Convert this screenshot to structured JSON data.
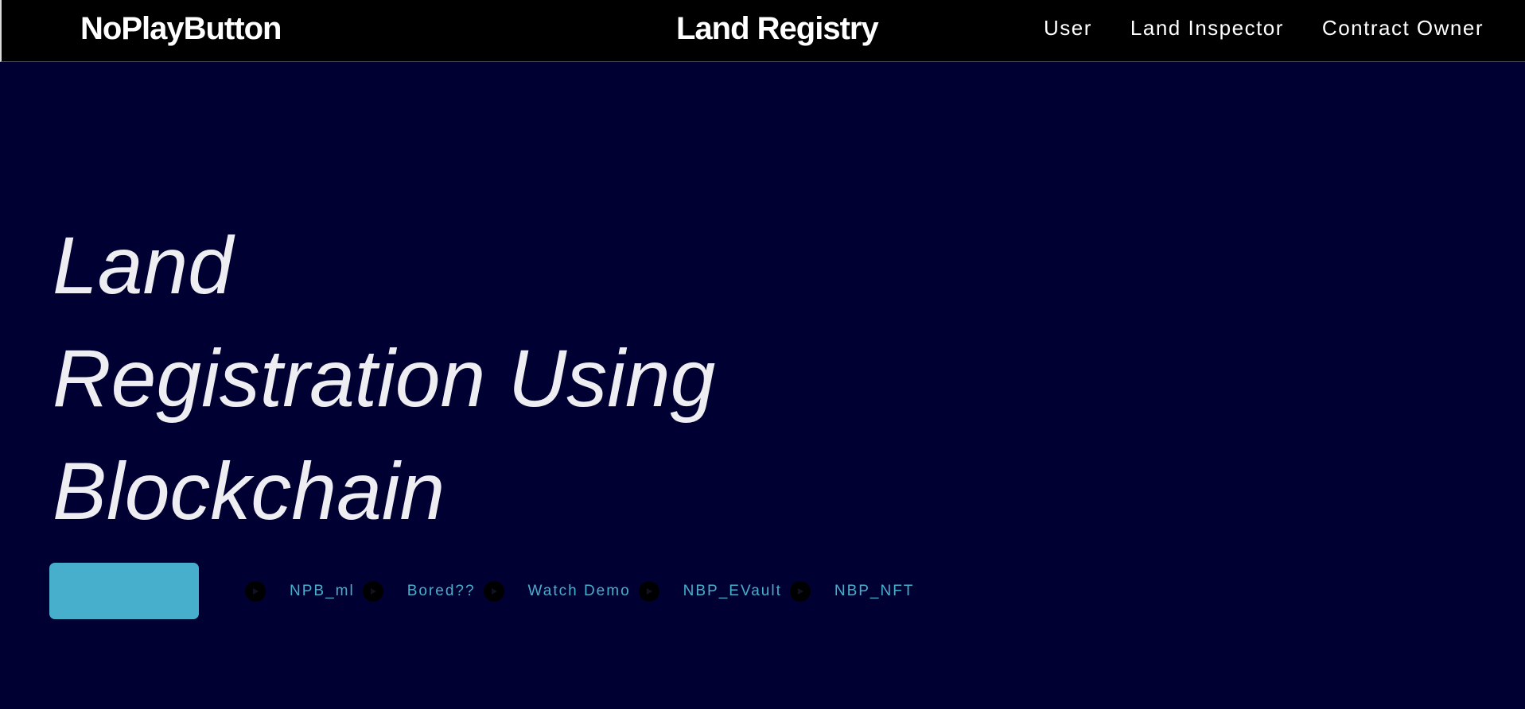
{
  "navbar": {
    "brand": "NoPlayButton",
    "title": "Land Registry",
    "links": [
      {
        "label": "User"
      },
      {
        "label": "Land Inspector"
      },
      {
        "label": "Contract Owner"
      }
    ]
  },
  "hero": {
    "title_lines": [
      "Land",
      "Registration Using",
      "Blockchain"
    ],
    "cta_label": ""
  },
  "external_links": [
    {
      "label": "NPB_ml",
      "icon": "play-circle-icon"
    },
    {
      "label": "Bored??",
      "icon": "play-circle-icon"
    },
    {
      "label": "Watch Demo",
      "icon": "play-circle-icon"
    },
    {
      "label": "NBP_EVault",
      "icon": "play-circle-icon"
    },
    {
      "label": "NBP_NFT",
      "icon": "play-circle-icon"
    }
  ],
  "colors": {
    "navbar_background": "#000000",
    "page_background": "#000033",
    "accent": "#47afcc",
    "hero_text": "#eeeef2"
  }
}
